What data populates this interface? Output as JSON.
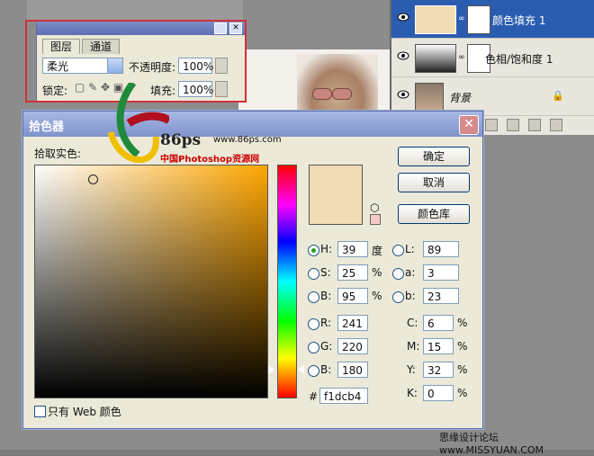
{
  "layers_panel": {
    "rows": [
      {
        "name": "颜色填充 1",
        "selected": true,
        "thumb_color": "#f1dcb4"
      },
      {
        "name": "色相/饱和度 1",
        "selected": false
      },
      {
        "name": "背景",
        "selected": false
      }
    ]
  },
  "layers_palette": {
    "tabs": [
      "图层",
      "通道"
    ],
    "blend_mode": "柔光",
    "opacity_label": "不透明度:",
    "opacity_value": "100%",
    "lock_label": "锁定:",
    "fill_label": "填充:",
    "fill_value": "100%"
  },
  "color_picker": {
    "title": "拾色器",
    "pick_label": "拾取实色:",
    "buttons": {
      "ok": "确定",
      "cancel": "取消",
      "libraries": "颜色库"
    },
    "hsb": {
      "h_label": "H:",
      "h": "39",
      "h_unit": "度",
      "s_label": "S:",
      "s": "25",
      "s_unit": "%",
      "b_label": "B:",
      "b": "95",
      "b_unit": "%"
    },
    "rgb": {
      "r_label": "R:",
      "r": "241",
      "g_label": "G:",
      "g": "220",
      "b_label": "B:",
      "b": "180"
    },
    "lab": {
      "l_label": "L:",
      "l": "89",
      "a_label": "a:",
      "a": "3",
      "b_label": "b:",
      "b": "23"
    },
    "cmyk": {
      "c_label": "C:",
      "c": "6",
      "m_label": "M:",
      "m": "15",
      "y_label": "Y:",
      "y": "32",
      "k_label": "K:",
      "k": "0",
      "unit": "%"
    },
    "hex_label": "#",
    "hex": "f1dcb4",
    "web_only_label": "只有 Web 颜色",
    "current_color": "#f1dcb4",
    "selected_mode": "H"
  },
  "watermark": {
    "logo_text": "86ps",
    "url": "www.86ps.com",
    "site_name": "中国Photoshop资源网",
    "footer": "思缘设计论坛 www.MISSYUAN.COM"
  }
}
